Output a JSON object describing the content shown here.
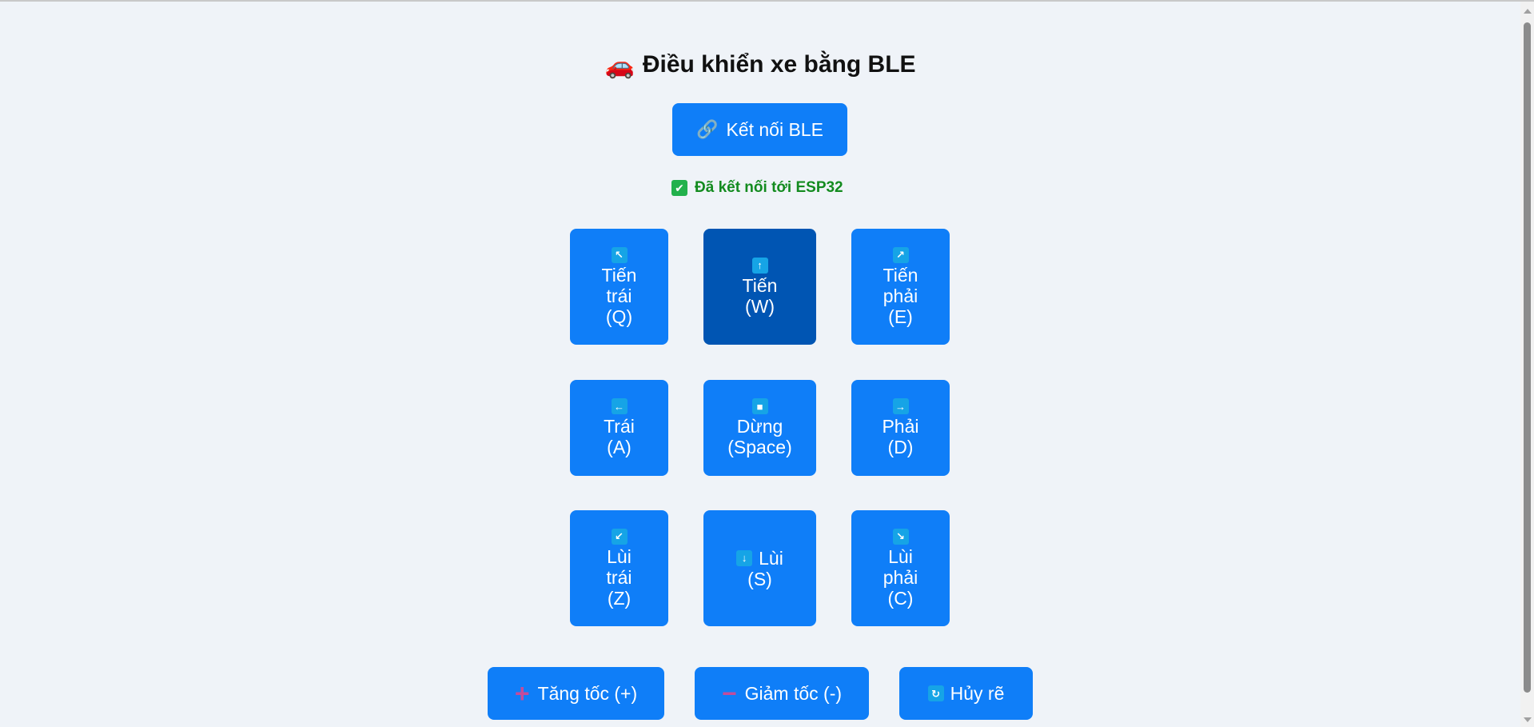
{
  "header": {
    "car_icon": "🚗",
    "title": "Điều khiển xe bằng BLE"
  },
  "connect": {
    "icon": "link-icon",
    "label": "Kết nối BLE"
  },
  "status": {
    "icon": "check-icon",
    "text": "Đã kết nối tới ESP32",
    "color": "#138b1f"
  },
  "controls": {
    "forward_left": {
      "icon": "↖",
      "line1": "Tiến",
      "line2": "trái",
      "line3": "(Q)"
    },
    "forward": {
      "icon": "↑",
      "line1": "Tiến",
      "line2": "(W)"
    },
    "forward_right": {
      "icon": "↗",
      "line1": "Tiến",
      "line2": "phải",
      "line3": "(E)"
    },
    "left": {
      "icon": "←",
      "line1": "Trái",
      "line2": "(A)"
    },
    "stop": {
      "icon": "■",
      "line1": "Dừng",
      "line2": "(Space)"
    },
    "right": {
      "icon": "→",
      "line1": "Phải",
      "line2": "(D)"
    },
    "back_left": {
      "icon": "↙",
      "line1": "Lùi",
      "line2": "trái",
      "line3": "(Z)"
    },
    "back": {
      "icon": "↓",
      "line1": "Lùi",
      "line2": "(S)"
    },
    "back_right": {
      "icon": "↘",
      "line1": "Lùi",
      "line2": "phải",
      "line3": "(C)"
    }
  },
  "bottom": {
    "speed_up": {
      "icon": "+",
      "label": "Tăng tốc (+)"
    },
    "speed_down": {
      "icon": "−",
      "label": "Giảm tốc (-)"
    },
    "cancel_turn": {
      "icon": "↻",
      "label": "Hủy rẽ"
    }
  },
  "colors": {
    "button": "#0f7ef8",
    "active_button": "#0055b3",
    "background": "#eff3f8"
  }
}
